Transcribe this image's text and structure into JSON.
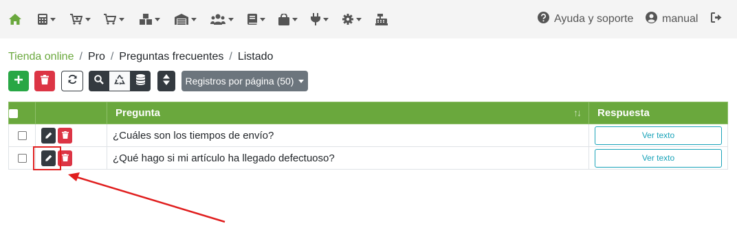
{
  "navbar": {
    "icons": [
      "home-icon",
      "calculator-icon",
      "cart-plus-icon",
      "cart-icon",
      "boxes-icon",
      "warehouse-icon",
      "users-icon",
      "book-icon",
      "shopping-bag-icon",
      "plug-icon",
      "gear-icon",
      "cash-register-icon"
    ],
    "help_label": "Ayuda y soporte",
    "user_label": "manual"
  },
  "breadcrumb": {
    "items": [
      "Tienda online",
      "Pro",
      "Preguntas frecuentes",
      "Listado"
    ],
    "separator": "/"
  },
  "toolbar": {
    "records_label": "Registros por página (50)"
  },
  "table": {
    "headers": {
      "question": "Pregunta",
      "answer": "Respuesta",
      "sort_indicator": "↑↓"
    },
    "rows": [
      {
        "question": "¿Cuáles son los tiempos de envío?",
        "answer_button": "Ver texto"
      },
      {
        "question": "¿Qué hago si mi artículo ha llegado defectuoso?",
        "answer_button": "Ver texto"
      }
    ]
  },
  "colors": {
    "accent": "#6aa83d",
    "danger": "#dc3545",
    "success": "#28a745",
    "dark": "#343a40",
    "info": "#17a2b8",
    "annotation": "#e01e1e"
  }
}
